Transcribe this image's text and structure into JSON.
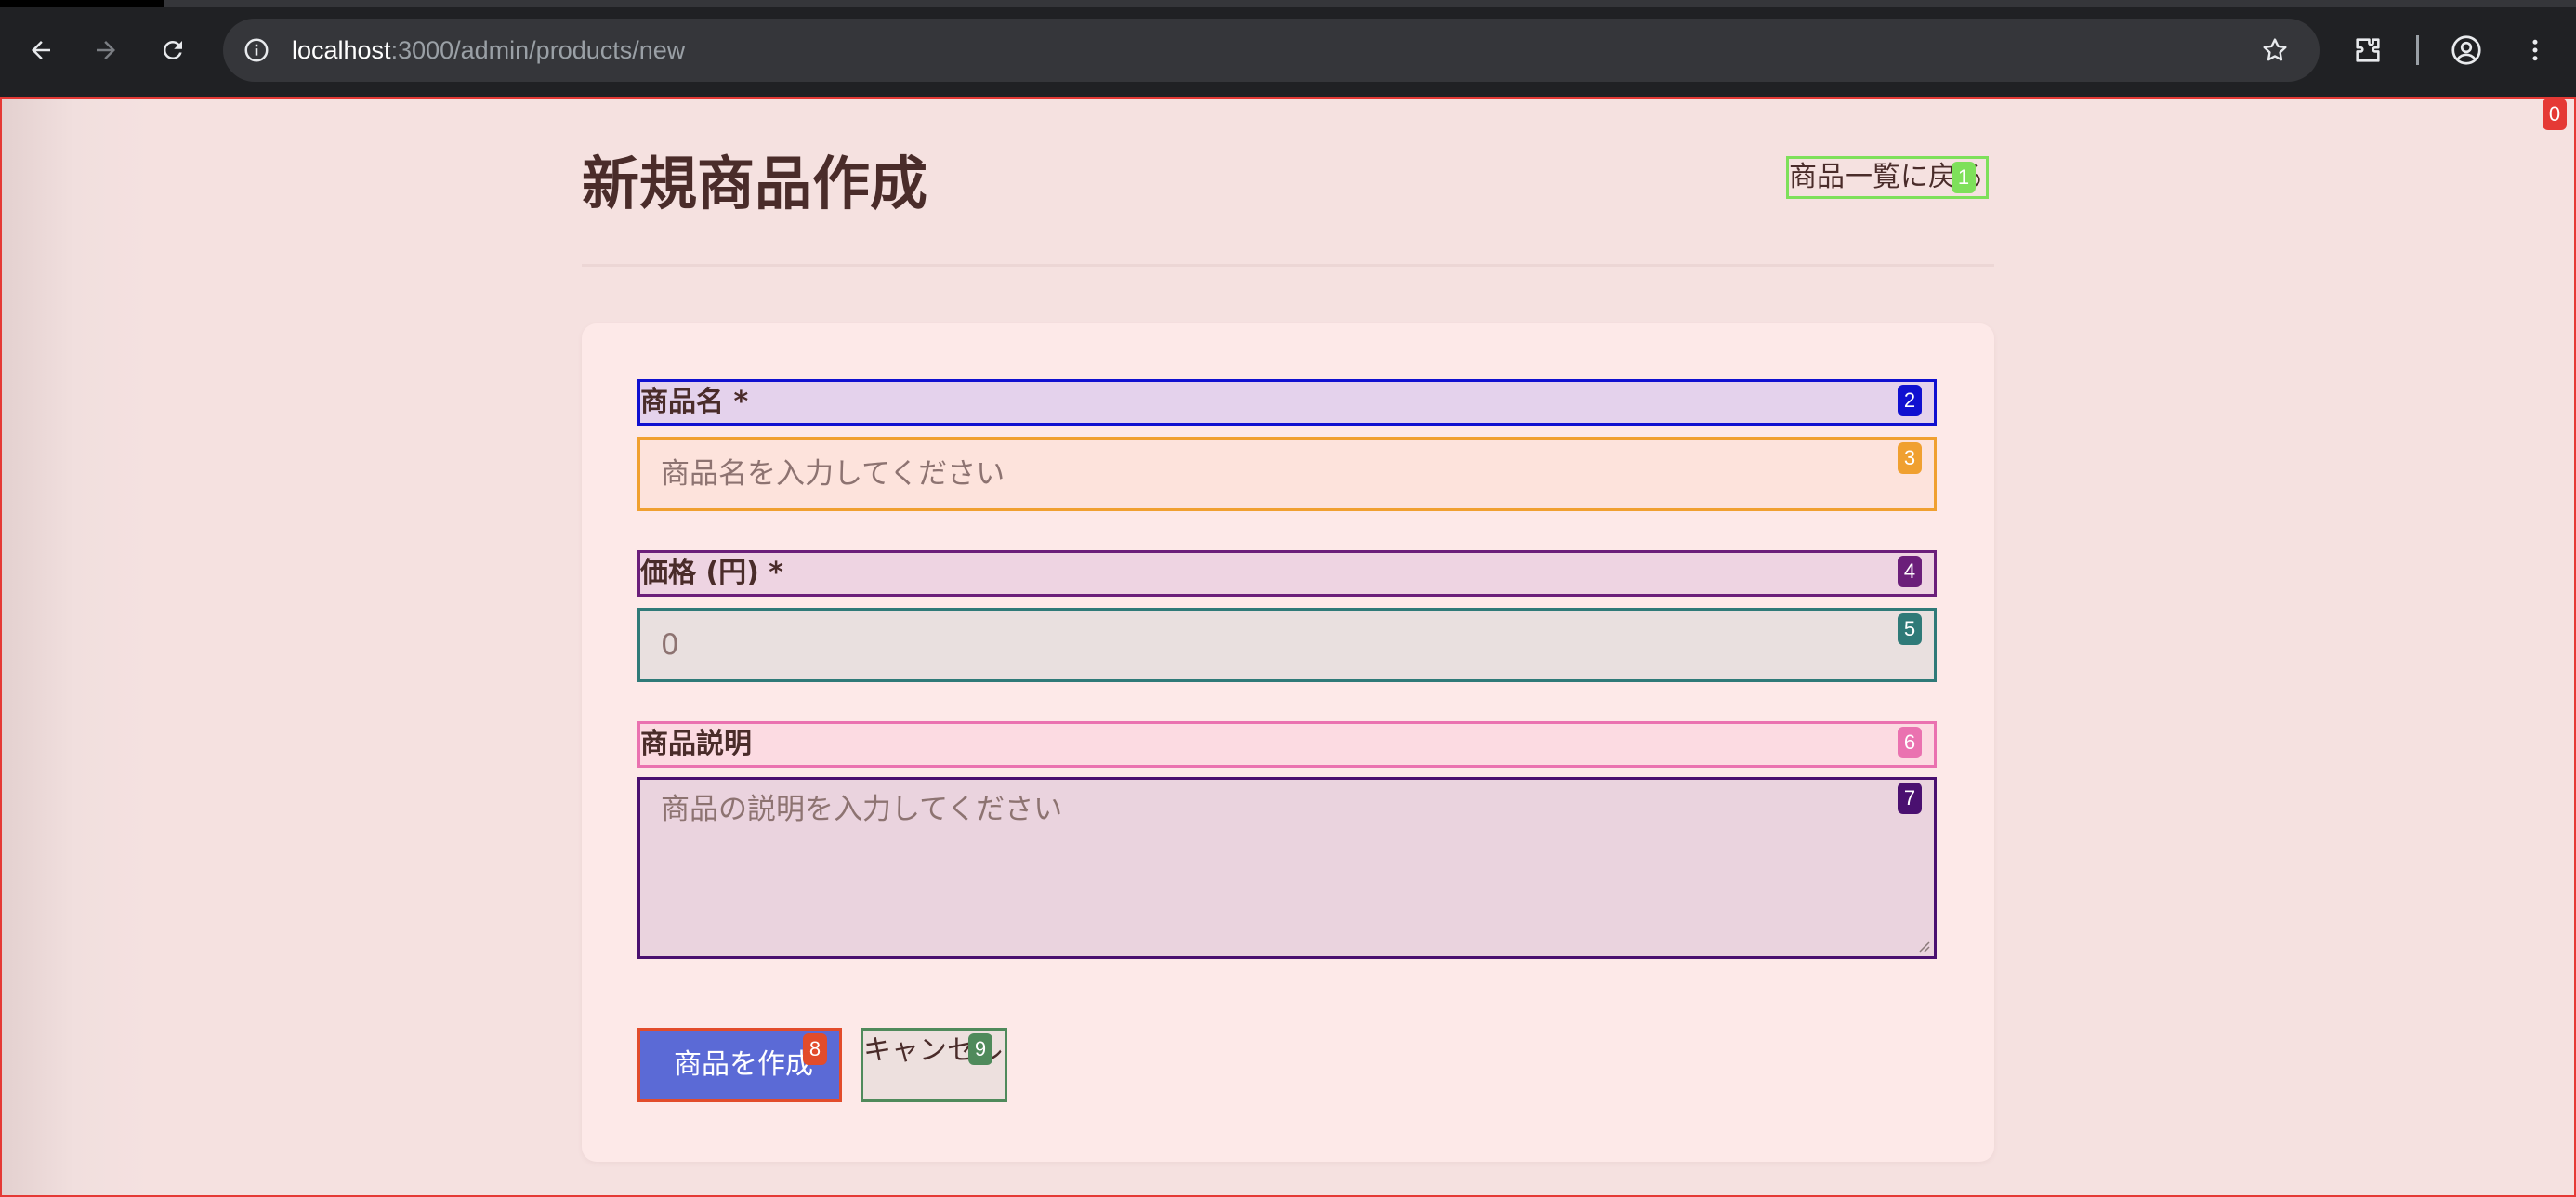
{
  "browser": {
    "url_host": "localhost",
    "url_path": ":3000/admin/products/new",
    "back_icon": "arrow-left-icon",
    "forward_icon": "arrow-right-icon",
    "reload_icon": "reload-icon",
    "site_info_icon": "info-icon",
    "bookmark_icon": "star-icon",
    "extensions_icon": "puzzle-icon",
    "profile_icon": "account-circle-icon",
    "menu_icon": "kebab-menu-icon"
  },
  "page": {
    "title": "新規商品作成",
    "back_link": "商品一覧に戻る"
  },
  "form": {
    "name_label": "商品名 *",
    "name_placeholder": "商品名を入力してください",
    "price_label": "価格 (円) *",
    "price_placeholder": "0",
    "description_label": "商品説明",
    "description_placeholder": "商品の説明を入力してください",
    "submit_label": "商品を作成",
    "cancel_label": "キャンセル"
  },
  "overlay_badges": [
    "0",
    "1",
    "2",
    "3",
    "4",
    "5",
    "6",
    "7",
    "8",
    "9"
  ],
  "colors": {
    "primary_button": "#5b6ad6",
    "page_background": "#f5e1e0",
    "card_background": "#fde9e8",
    "text": "#4a2c2a"
  }
}
